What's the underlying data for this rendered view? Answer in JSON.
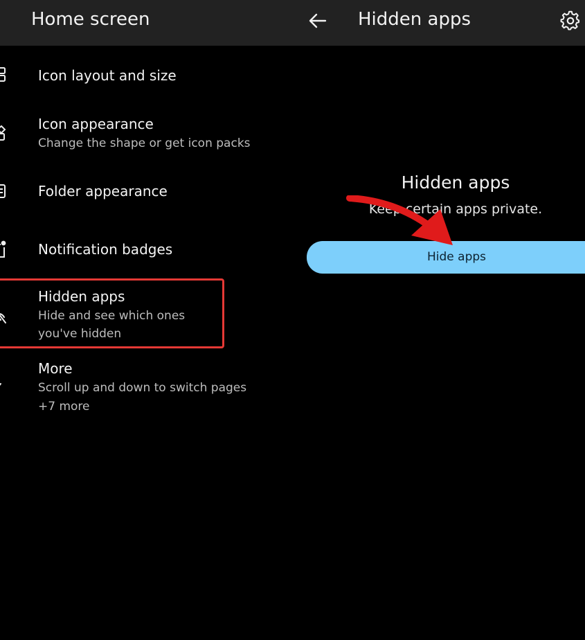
{
  "left_panel": {
    "title": "Home screen",
    "items": [
      {
        "icon": "grid-icon",
        "title": "Icon layout and size",
        "subtitle": ""
      },
      {
        "icon": "shapes-icon",
        "title": "Icon appearance",
        "subtitle": "Change the shape or get icon packs"
      },
      {
        "icon": "folder-grid-icon",
        "title": "Folder appearance",
        "subtitle": ""
      },
      {
        "icon": "badge-icon",
        "title": "Notification badges",
        "subtitle": ""
      },
      {
        "icon": "hidden-eye-icon",
        "title": "Hidden apps",
        "subtitle": "Hide and see which ones you've hidden"
      },
      {
        "icon": "more-icon",
        "title": "More",
        "subtitle": "Scroll up and down to switch pages",
        "extra": "+7 more"
      }
    ]
  },
  "right_panel": {
    "back_icon": "back-arrow-icon",
    "title": "Hidden apps",
    "settings_icon": "gear-icon",
    "empty_title": "Hidden apps",
    "empty_desc": "Keep certain apps private.",
    "button_label": "Hide apps"
  },
  "colors": {
    "background": "#000000",
    "topbar": "#222222",
    "button": "#7dcffb",
    "highlight": "#e53935",
    "annotation_arrow": "#e01b1b"
  }
}
